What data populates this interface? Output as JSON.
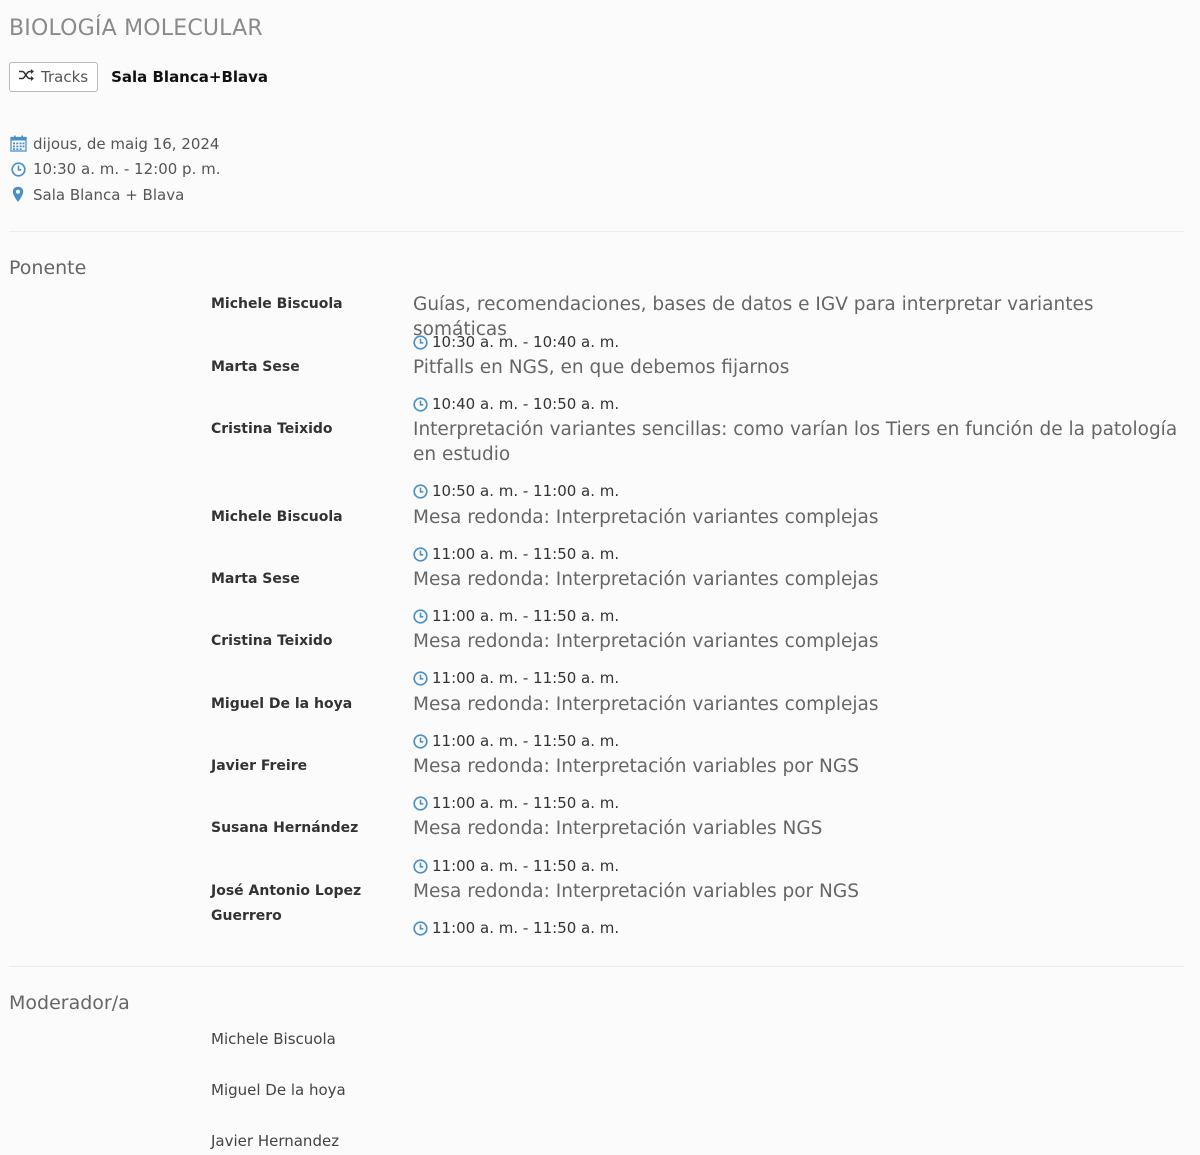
{
  "title": "BIOLOGÍA MOLECULAR",
  "tracks_button": {
    "label": "Tracks",
    "icon": "shuffle-icon"
  },
  "track_name": "Sala Blanca+Blava",
  "meta": {
    "date": "dijous, de maig 16, 2024",
    "time": "10:30 a. m. - 12:00 p. m.",
    "location": "Sala Blanca + Blava"
  },
  "colors": {
    "accent": "#4a90c8"
  },
  "ponente_heading": "Ponente",
  "sessions": [
    {
      "speaker": "Michele Biscuola",
      "title": "Guías, recomendaciones, bases de datos e IGV para interpretar variantes somáticas",
      "time": "10:30 a. m. - 10:40 a. m."
    },
    {
      "speaker": "Marta Sese",
      "title": "Pitfalls en NGS, en que debemos fijarnos",
      "time": "10:40 a. m. - 10:50 a. m."
    },
    {
      "speaker": "Cristina Teixido",
      "title": "Interpretación variantes sencillas: como varían los Tiers en función de la patología en estudio",
      "time": "10:50 a. m. - 11:00 a. m."
    },
    {
      "speaker": "Michele Biscuola",
      "title": "Mesa redonda: Interpretación variantes complejas",
      "time": "11:00 a. m. - 11:50 a. m."
    },
    {
      "speaker": "Marta Sese",
      "title": "Mesa redonda: Interpretación variantes complejas",
      "time": "11:00 a. m. - 11:50 a. m."
    },
    {
      "speaker": "Cristina Teixido",
      "title": "Mesa redonda: Interpretación variantes complejas",
      "time": "11:00 a. m. - 11:50 a. m."
    },
    {
      "speaker": "Miguel De la hoya",
      "title": "Mesa redonda: Interpretación variantes complejas",
      "time": "11:00 a. m. - 11:50 a. m."
    },
    {
      "speaker": "Javier Freire",
      "title": "Mesa redonda: Interpretación variables por NGS",
      "time": "11:00 a. m. - 11:50 a. m."
    },
    {
      "speaker": "Susana Hernández",
      "title": "Mesa redonda: Interpretación variables NGS",
      "time": "11:00 a. m. - 11:50 a. m."
    },
    {
      "speaker": "José Antonio Lopez Guerrero",
      "title": "Mesa redonda: Interpretación variables por NGS",
      "time": "11:00 a. m. - 11:50 a. m."
    }
  ],
  "moderador_heading": "Moderador/a",
  "moderators": [
    "Michele Biscuola",
    "Miguel De la hoya",
    "Javier Hernandez"
  ]
}
